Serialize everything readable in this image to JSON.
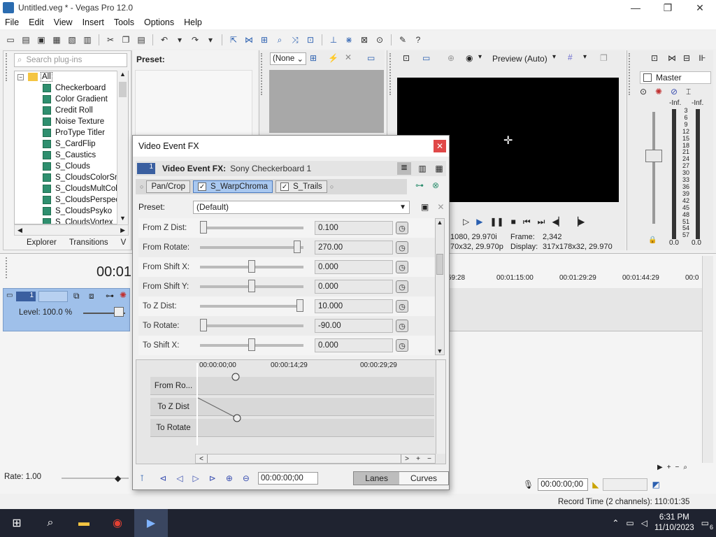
{
  "window": {
    "title": "Untitled.veg * - Vegas Pro 12.0",
    "controls": [
      "—",
      "❐",
      "✕"
    ]
  },
  "menu": [
    "File",
    "Edit",
    "View",
    "Insert",
    "Tools",
    "Options",
    "Help"
  ],
  "plugins": {
    "search_placeholder": "Search plug-ins",
    "root": "All",
    "items": [
      "Checkerboard",
      "Color Gradient",
      "Credit Roll",
      "Noise Texture",
      "ProType Titler",
      "S_CardFlip",
      "S_Caustics",
      "S_Clouds",
      "S_CloudsColorSmo",
      "S_CloudsMultColo",
      "S_CloudsPerspect",
      "S_CloudsPsyko",
      "S_CloudsVortex"
    ],
    "preset_label": "Preset:",
    "tabs": [
      "Explorer",
      "Transitions",
      "V"
    ]
  },
  "trimmer": {
    "preset_value": "(None"
  },
  "preview": {
    "mode": "Preview (Auto)",
    "frame_label": "Frame:",
    "frame_value": "2,342",
    "display_label": "Display:",
    "display_value": "317x178x32, 29.970",
    "project_res": "1080, 29.970i",
    "project_res2": "70x32, 29.970p"
  },
  "mixer": {
    "title": "Master",
    "left_top": "-Inf.",
    "right_top": "-Inf.",
    "scale": [
      "3",
      "6",
      "9",
      "12",
      "15",
      "18",
      "21",
      "24",
      "27",
      "30",
      "33",
      "36",
      "39",
      "42",
      "45",
      "48",
      "51",
      "54",
      "57"
    ],
    "left_bottom": "0.0",
    "right_bottom": "0.0"
  },
  "timeline": {
    "time_display": "00:01",
    "ruler": [
      "59:28",
      "00:01:15:00",
      "00:01:29:29",
      "00:01:44:29",
      "00:0"
    ],
    "track_number": "1",
    "level": "Level: 100.0 %",
    "rate": "Rate: 1.00",
    "cursor_time": "00:00:00;00",
    "record_time": "Record Time (2 channels): 110:01:35"
  },
  "dialog": {
    "title": "Video Event FX",
    "close": "✕",
    "track_no": "1",
    "fx_label": "Video Event FX:",
    "fx_name": "Sony Checkerboard 1",
    "chain": [
      "Pan/Crop",
      "S_WarpChroma",
      "S_Trails"
    ],
    "preset_label": "Preset:",
    "preset_value": "(Default)",
    "params": [
      {
        "label": "From Z Dist:",
        "value": "0.100",
        "pos": 0.0
      },
      {
        "label": "From Rotate:",
        "value": "270.00",
        "pos": 0.97
      },
      {
        "label": "From Shift X:",
        "value": "0.000",
        "pos": 0.5
      },
      {
        "label": "From Shift Y:",
        "value": "0.000",
        "pos": 0.5
      },
      {
        "label": "To Z Dist:",
        "value": "10.000",
        "pos": 1.0
      },
      {
        "label": "To Rotate:",
        "value": "-90.00",
        "pos": 0.0
      },
      {
        "label": "To Shift X:",
        "value": "0.000",
        "pos": 0.5
      }
    ],
    "kf_ruler": [
      "00:00:00;00",
      "00:00:14;29",
      "00:00:29;29"
    ],
    "lanes": [
      "From Ro...",
      "To Z Dist",
      "To Rotate"
    ],
    "time_value": "00:00:00;00",
    "view_lanes": "Lanes",
    "view_curves": "Curves"
  },
  "taskbar": {
    "time": "6:31 PM",
    "date": "11/10/2023",
    "notifications": "6"
  }
}
